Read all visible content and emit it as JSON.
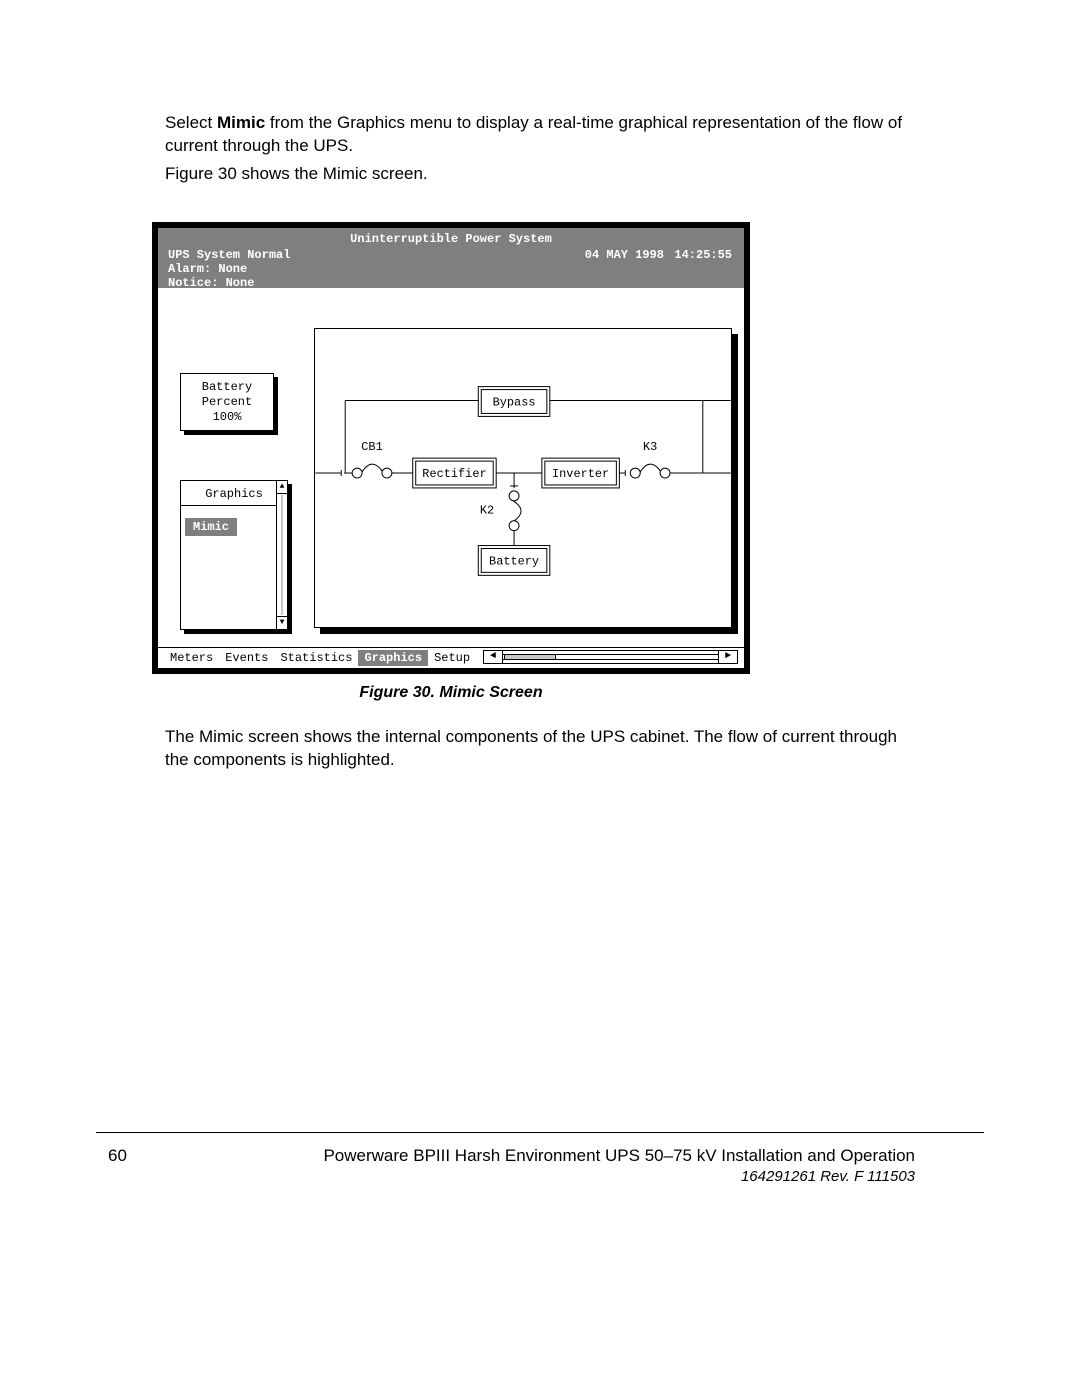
{
  "paragraphs": {
    "p1_a": "Select ",
    "p1_b": "Mimic",
    "p1_c": " from the Graphics menu to display a real-time graphical representation of the flow of current through the UPS.",
    "p2": "Figure 30 shows the Mimic screen.",
    "p3": "The Mimic screen shows the internal components of the UPS cabinet.  The flow of current through the components is highlighted."
  },
  "screen": {
    "header": {
      "title": "Uninterruptible Power System",
      "status": "UPS System Normal",
      "alarm": "Alarm:  None",
      "notice": "Notice: None",
      "date": "04 MAY 1998",
      "time": "14:25:55"
    },
    "battery_box": {
      "line1": "Battery",
      "line2": "Percent",
      "line3": "100%"
    },
    "graphics_menu": {
      "title": "Graphics",
      "item": "Mimic"
    },
    "diagram": {
      "bypass": "Bypass",
      "rectifier": "Rectifier",
      "inverter": "Inverter",
      "battery": "Battery",
      "cb1": "CB1",
      "k2": "K2",
      "k3": "K3"
    },
    "menubar": {
      "meters": "Meters",
      "events": "Events",
      "statistics": "Statistics",
      "graphics": "Graphics",
      "setup": "Setup"
    }
  },
  "figure_caption": "Figure 30.  Mimic Screen",
  "footer": {
    "page": "60",
    "title": "Powerware BPIII Harsh Environment UPS 50–75 kV Installation and Operation",
    "rev": "164291261 Rev. F   111503"
  }
}
